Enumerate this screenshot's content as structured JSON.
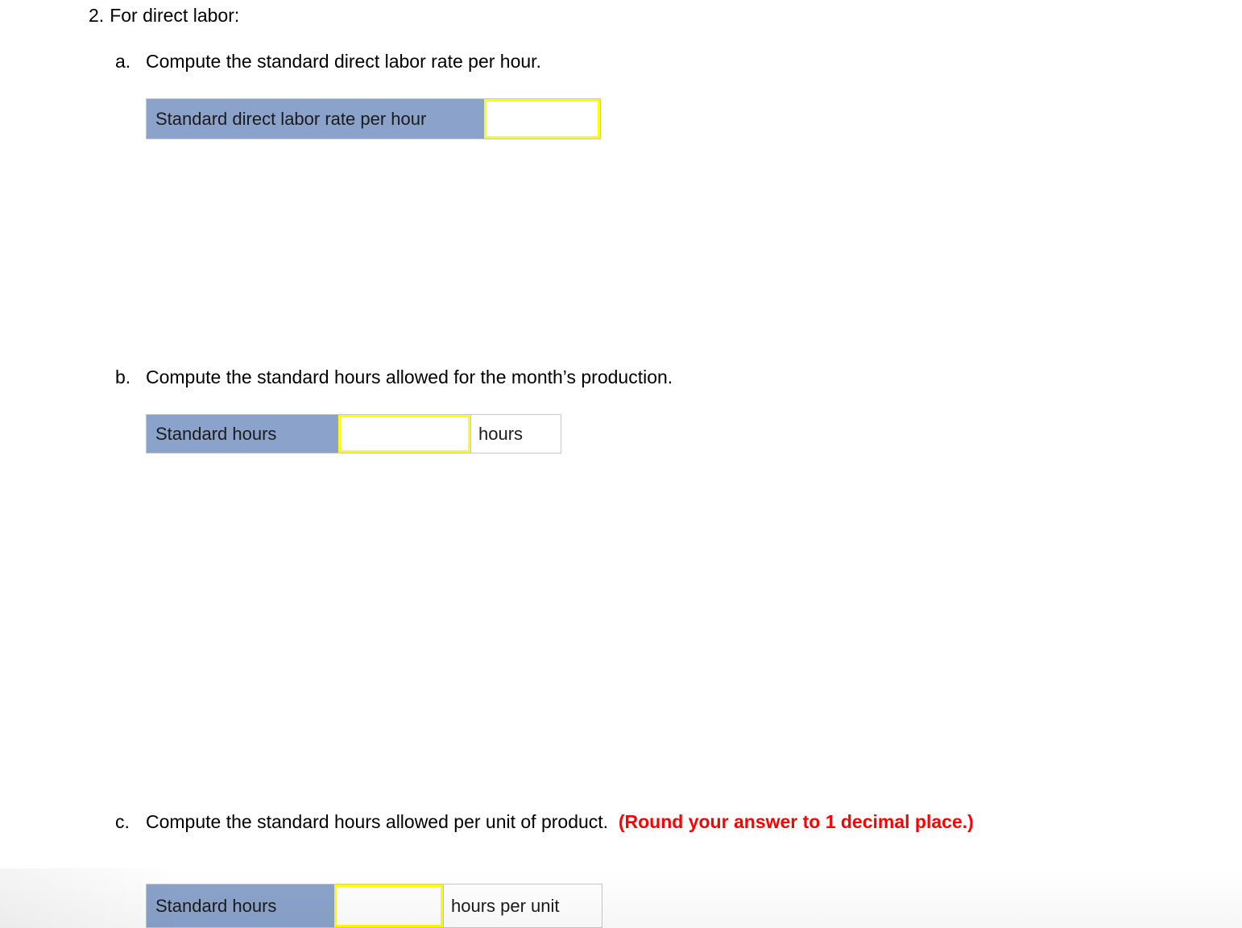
{
  "question": {
    "number": "2.",
    "text": "For direct labor:"
  },
  "parts": [
    {
      "letter": "a.",
      "prompt": "Compute the standard direct labor rate per hour.",
      "table": {
        "label": "Standard direct labor rate per hour",
        "value": "",
        "placeholder": "",
        "unit": null
      }
    },
    {
      "letter": "b.",
      "prompt": "Compute the standard hours allowed for the month’s production.",
      "table": {
        "label": "Standard hours",
        "value": "",
        "placeholder": "",
        "unit": "hours"
      }
    },
    {
      "letter": "c.",
      "prompt": "Compute the standard hours allowed per unit of product.",
      "hint": "(Round your answer to 1 decimal place.)",
      "table": {
        "label": "Standard hours",
        "value": "",
        "placeholder": "",
        "unit": "hours per unit"
      }
    }
  ],
  "colors": {
    "label_cell_blue": "#8ba3cb",
    "input_focus_yellow": "#ffff00",
    "table_border_gray": "#c8c8c8",
    "hint_red": "#ff0000",
    "text_black": "#000000"
  }
}
